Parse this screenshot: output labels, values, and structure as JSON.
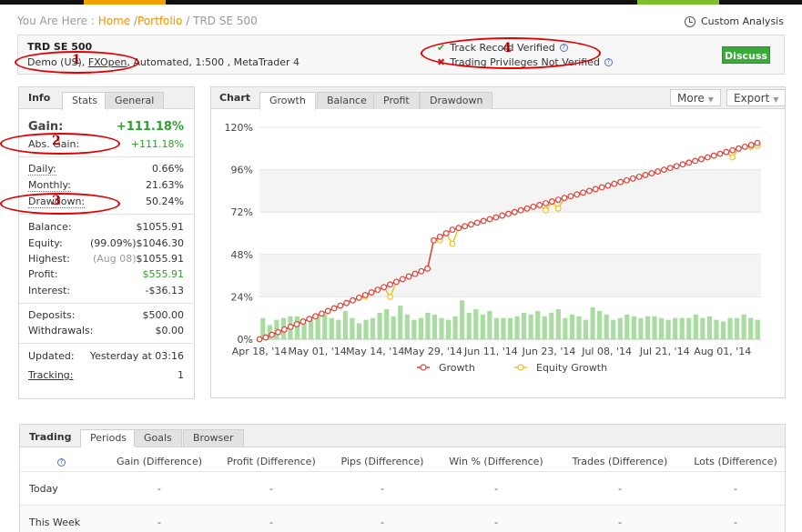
{
  "breadcrumb": {
    "prefix": "You Are Here :",
    "home": "Home",
    "sep1": "/",
    "portfolio": "Portfolio",
    "sep2": "/",
    "current": "TRD SE 500"
  },
  "custom_analysis": "Custom Analysis",
  "account": {
    "title": "TRD SE 500",
    "type_prefix": "Demo (US",
    "type_suffix": "), ",
    "broker": "FXOpen",
    "details": ", Automated, 1:500 , MetaTrader 4"
  },
  "verification": {
    "track_record": "Track Record Verified",
    "trading_privileges": "Trading Privileges Not Verified"
  },
  "discuss_label": "Discuss",
  "info": {
    "title": "Info",
    "tabs": [
      "Stats",
      "General"
    ],
    "gain": {
      "label": "Gain:",
      "value": "+111.18%"
    },
    "abs_gain": {
      "label": "Abs. Gain:",
      "value": "+111.18%"
    },
    "daily": {
      "label": "Daily:",
      "value": "0.66%"
    },
    "monthly": {
      "label": "Monthly:",
      "value": "21.63%"
    },
    "drawdown": {
      "label": "Drawdown:",
      "value": "50.24%"
    },
    "balance": {
      "label": "Balance:",
      "value": "$1055.91"
    },
    "equity": {
      "label": "Equity:",
      "pct": "(99.09%)",
      "value": "$1046.30"
    },
    "highest": {
      "label": "Highest:",
      "date": "(Aug 08)",
      "value": "$1055.91"
    },
    "profit": {
      "label": "Profit:",
      "value": "$555.91"
    },
    "interest": {
      "label": "Interest:",
      "value": "-$36.13"
    },
    "deposits": {
      "label": "Deposits:",
      "value": "$500.00"
    },
    "withdrawals": {
      "label": "Withdrawals:",
      "value": "$0.00"
    },
    "updated": {
      "label": "Updated:",
      "value": "Yesterday at 03:16"
    },
    "tracking": {
      "label": "Tracking:",
      "value": "1"
    }
  },
  "chart": {
    "title": "Chart",
    "tabs": [
      "Growth",
      "Balance",
      "Profit",
      "Drawdown"
    ],
    "more_label": "More",
    "export_label": "Export"
  },
  "chart_data": {
    "type": "line",
    "ylim": [
      0,
      120
    ],
    "y_ticks": [
      "0%",
      "24%",
      "48%",
      "72%",
      "96%",
      "120%"
    ],
    "x_ticks": [
      "Apr 18, '14",
      "May 01, '14",
      "May 14, '14",
      "May 29, '14",
      "Jun 11, '14",
      "Jun 23, '14",
      "Jul 08, '14",
      "Jul 21, '14",
      "Aug 01, '14"
    ],
    "legend": "bottom",
    "grid": true,
    "series": [
      {
        "name": "Growth",
        "color": "#e04040",
        "values": [
          0,
          1,
          2.5,
          4,
          5.5,
          7,
          8.5,
          10,
          11.5,
          13,
          14.5,
          16,
          17.5,
          19,
          20.5,
          22,
          23.5,
          25,
          26.5,
          28,
          29.5,
          31,
          32.5,
          34,
          35.5,
          37,
          38.5,
          40,
          56,
          58,
          60,
          62,
          63,
          64,
          65,
          66,
          67,
          68,
          69,
          70,
          71,
          72,
          73,
          74,
          75,
          76,
          77,
          78,
          79,
          80,
          81,
          82,
          83,
          84,
          85,
          86,
          87,
          88,
          89,
          90,
          91,
          92,
          93,
          94,
          95,
          96,
          97,
          98,
          99,
          100,
          101,
          102,
          103,
          104,
          105,
          106,
          107,
          108,
          109,
          110,
          111.18
        ]
      },
      {
        "name": "Equity Growth",
        "color": "#f0c020",
        "values": [
          0,
          1,
          2.5,
          4,
          5.5,
          7,
          8.5,
          10,
          11.5,
          13,
          14.5,
          16,
          17.5,
          19,
          20.5,
          22,
          23.5,
          24,
          26.5,
          28,
          29.5,
          24,
          32.5,
          34,
          35.5,
          37,
          38.5,
          40,
          56,
          56,
          60,
          54,
          63,
          64,
          65,
          66,
          67,
          68,
          69,
          70,
          71,
          72,
          73,
          74,
          75,
          76,
          73,
          78,
          74,
          80,
          81,
          82,
          83,
          84,
          85,
          86,
          87,
          88,
          89,
          90,
          91,
          92,
          93,
          94,
          95,
          96,
          97,
          98,
          99,
          100,
          101,
          102,
          103,
          104,
          105,
          106,
          103,
          108,
          109,
          109,
          109.5
        ]
      }
    ],
    "bars": [
      12,
      8,
      11,
      12,
      13,
      13,
      10,
      11,
      13,
      14,
      12,
      11,
      16,
      12,
      9,
      11,
      12,
      15,
      17,
      13,
      19,
      14,
      11,
      12,
      15,
      14,
      12,
      11,
      13,
      22,
      15,
      17,
      14,
      16,
      12,
      12,
      12,
      13,
      15,
      14,
      16,
      13,
      15,
      17,
      12,
      14,
      13,
      11,
      18,
      16,
      14,
      11,
      12,
      14,
      13,
      12,
      13,
      13,
      12,
      11,
      12,
      12,
      12,
      14,
      12,
      13,
      11,
      10,
      12,
      12,
      14,
      12,
      11
    ]
  },
  "trading": {
    "title": "Trading",
    "tabs": [
      "Periods",
      "Goals",
      "Browser"
    ],
    "columns": [
      "Gain (Difference)",
      "Profit (Difference)",
      "Pips (Difference)",
      "Win % (Difference)",
      "Trades (Difference)",
      "Lots (Difference)"
    ],
    "rows": [
      {
        "label": "Today",
        "cells": [
          "-",
          "-",
          "-",
          "-",
          "-",
          "-"
        ]
      },
      {
        "label": "This Week",
        "cells": [
          "-",
          "-",
          "-",
          "-",
          "-",
          "-"
        ]
      }
    ]
  },
  "annotations": [
    "1",
    "2",
    "3",
    "4"
  ]
}
